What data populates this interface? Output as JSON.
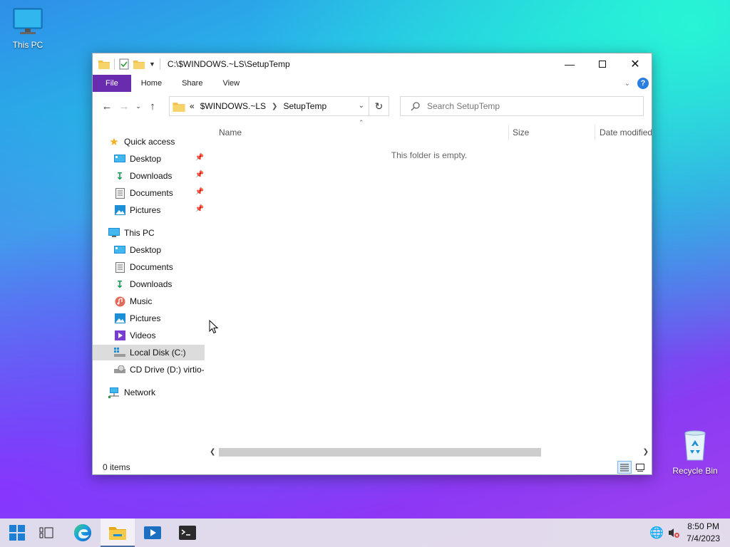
{
  "desktop": {
    "this_pc_label": "This PC",
    "recycle_bin_label": "Recycle Bin"
  },
  "window": {
    "title": "C:\\$WINDOWS.~LS\\SetupTemp",
    "ribbon_tabs": [
      "File",
      "Home",
      "Share",
      "View"
    ],
    "address": {
      "prefix": "«",
      "crumbs": [
        "$WINDOWS.~LS",
        "SetupTemp"
      ]
    },
    "search_placeholder": "Search SetupTemp",
    "columns": [
      "Name",
      "Size",
      "Date modified"
    ],
    "empty_message": "This folder is empty.",
    "status_items": "0 items"
  },
  "nav_pane": {
    "quick_access": {
      "label": "Quick access",
      "items": [
        "Desktop",
        "Downloads",
        "Documents",
        "Pictures"
      ]
    },
    "this_pc": {
      "label": "This PC",
      "items": [
        "Desktop",
        "Documents",
        "Downloads",
        "Music",
        "Pictures",
        "Videos",
        "Local Disk (C:)",
        "CD Drive (D:) virtio-"
      ]
    },
    "network": {
      "label": "Network"
    },
    "selected": "Local Disk (C:)"
  },
  "taskbar": {
    "time": "8:50 PM",
    "date": "7/4/2023"
  },
  "colors": {
    "file_tab": "#6a2cae",
    "accent": "#2a7de1",
    "folder": "#f2c14e"
  }
}
